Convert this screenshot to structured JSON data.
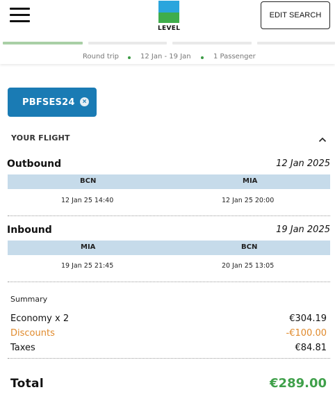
{
  "header": {
    "menu_icon": "hamburger-icon",
    "logo_text": "LEVEL",
    "logo_colors": {
      "top": "#2aa5dd",
      "bottom": "#3fad4b"
    },
    "edit_search_label": "EDIT SEARCH"
  },
  "progress_steps": [
    {
      "state": "complete"
    },
    {
      "state": "pending"
    },
    {
      "state": "pending"
    },
    {
      "state": "pending"
    }
  ],
  "trip_info": {
    "trip_type": "Round trip",
    "dates": "12 Jan - 19 Jan",
    "passengers": "1 Passenger"
  },
  "promo": {
    "code": "PBFSES24",
    "remove_icon": "close-circle-icon",
    "color": "#1a7bb4"
  },
  "flight_section": {
    "title": "YOUR FLIGHT",
    "toggle_icon": "chevron-up-icon"
  },
  "outbound": {
    "label": "Outbound",
    "date": "12 Jan 2025",
    "from": "BCN",
    "to": "MIA",
    "depart": "12 Jan 25 14:40",
    "arrive": "12 Jan 25 20:00"
  },
  "inbound": {
    "label": "Inbound",
    "date": "19 Jan 2025",
    "from": "MIA",
    "to": "BCN",
    "depart": "19 Jan 25 21:45",
    "arrive": "20 Jan 25 13:05"
  },
  "summary": {
    "title": "Summary",
    "rows": [
      {
        "label": "Economy x 2",
        "value": "€304.19"
      },
      {
        "label": "Discounts",
        "value": "-€100.00"
      },
      {
        "label": "Taxes",
        "value": "€84.81"
      }
    ],
    "total_label": "Total",
    "total_value": "€289.00",
    "discount_color": "#e08a2c",
    "total_color": "#3fa04a"
  }
}
